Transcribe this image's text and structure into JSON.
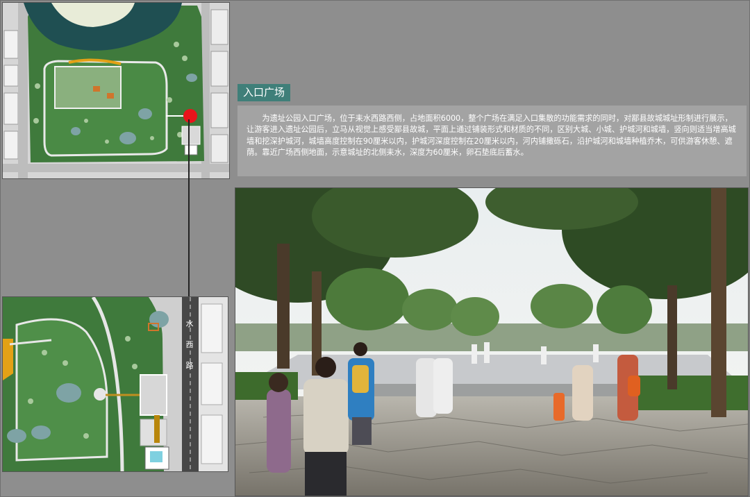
{
  "section": {
    "title": "入口广场",
    "description": "为遗址公园入口广场，位于耒水西路西侧，占地面积6000，整个广场在满足入口集散的功能需求的同时，对鄙县故城城址形制进行展示，让游客进入遗址公园后，立马从视觉上感受鄙县故城，平面上通过铺装形式和材质的不同，区别大城、小城、护城河和城墙，竖向则适当增高城墙和挖深护城河，城墙高度控制在90厘米以内，护城河深度控制在20厘米以内，河内铺撒砾石，沿护城河和城墙种植乔木，可供游客休憩、遮荫。靠近广场西侧地面，示意城址的北侧耒水，深度为60厘米，卵石垫底后蓄水。"
  },
  "plan_zoom": {
    "road_label": "水西路"
  },
  "colors": {
    "title_bg": "#3f7f79",
    "desc_bg": "#a3a3a3",
    "page_bg": "#8e8e8e",
    "marker_red": "#e8141b"
  },
  "icons": {
    "entrance_marker": "red-circle"
  }
}
